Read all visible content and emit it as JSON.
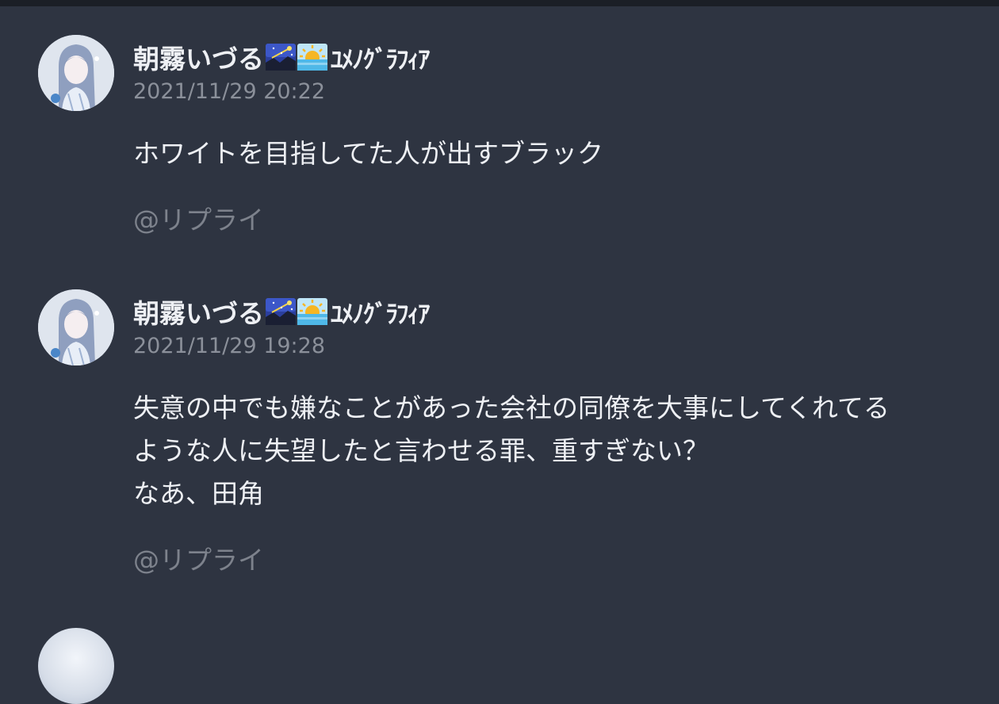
{
  "posts": [
    {
      "author": "朝霧いづる",
      "author_suffix": "ﾕﾒﾉｸﾞﾗﾌｨｱ",
      "emoji_icons": [
        "night-sky-shooting-star-icon",
        "sunrise-over-sea-icon"
      ],
      "timestamp": "2021/11/29 20:22",
      "lines": [
        "ホワイトを目指してた人が出すブラック"
      ],
      "reply_label": "@リプライ"
    },
    {
      "author": "朝霧いづる",
      "author_suffix": "ﾕﾒﾉｸﾞﾗﾌｨｱ",
      "emoji_icons": [
        "night-sky-shooting-star-icon",
        "sunrise-over-sea-icon"
      ],
      "timestamp": "2021/11/29 19:28",
      "lines": [
        "失意の中でも嫌なことがあった会社の同僚を大事にしてくれてる",
        "ような人に失望したと言わせる罪、重すぎない？",
        "なあ、田角"
      ],
      "reply_label": "@リプライ"
    }
  ],
  "colors": {
    "background": "#2e3441",
    "text": "#eef0f4",
    "muted": "#8b909a",
    "reply": "#7d828c"
  }
}
